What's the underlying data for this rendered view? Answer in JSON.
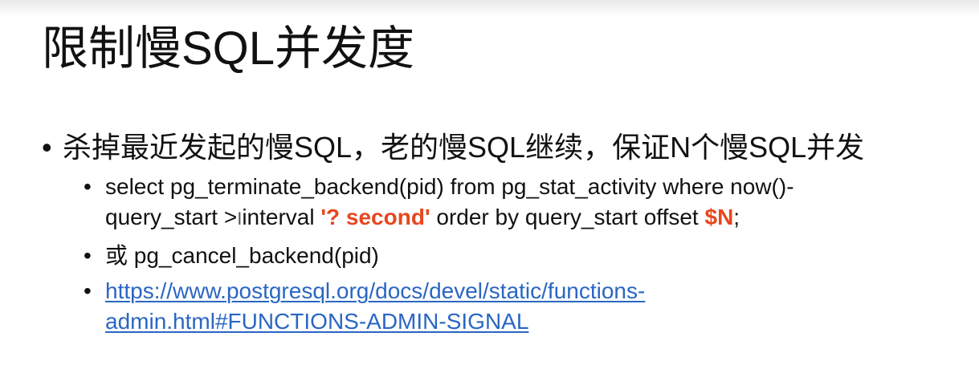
{
  "slide": {
    "title": "限制慢SQL并发度",
    "bullet": "杀掉最近发起的慢SQL，老的慢SQL继续，保证N个慢SQL并发",
    "sub1": {
      "part1": "select pg_terminate_backend(pid) from pg_stat_activity where now()-",
      "part2": "query_start >",
      "part3": "interval ",
      "highlight1": "'? second'",
      "part4": " order by query_start offset ",
      "highlight2": "$N",
      "part5": ";"
    },
    "sub2": "或 pg_cancel_backend(pid)",
    "sub3": {
      "link_line1": "https://www.postgresql.org/docs/devel/static/functions-",
      "link_line2": "admin.html#FUNCTIONS-ADMIN-SIGNAL"
    }
  },
  "colors": {
    "highlight": "#e8461e",
    "link": "#2a66c4"
  }
}
